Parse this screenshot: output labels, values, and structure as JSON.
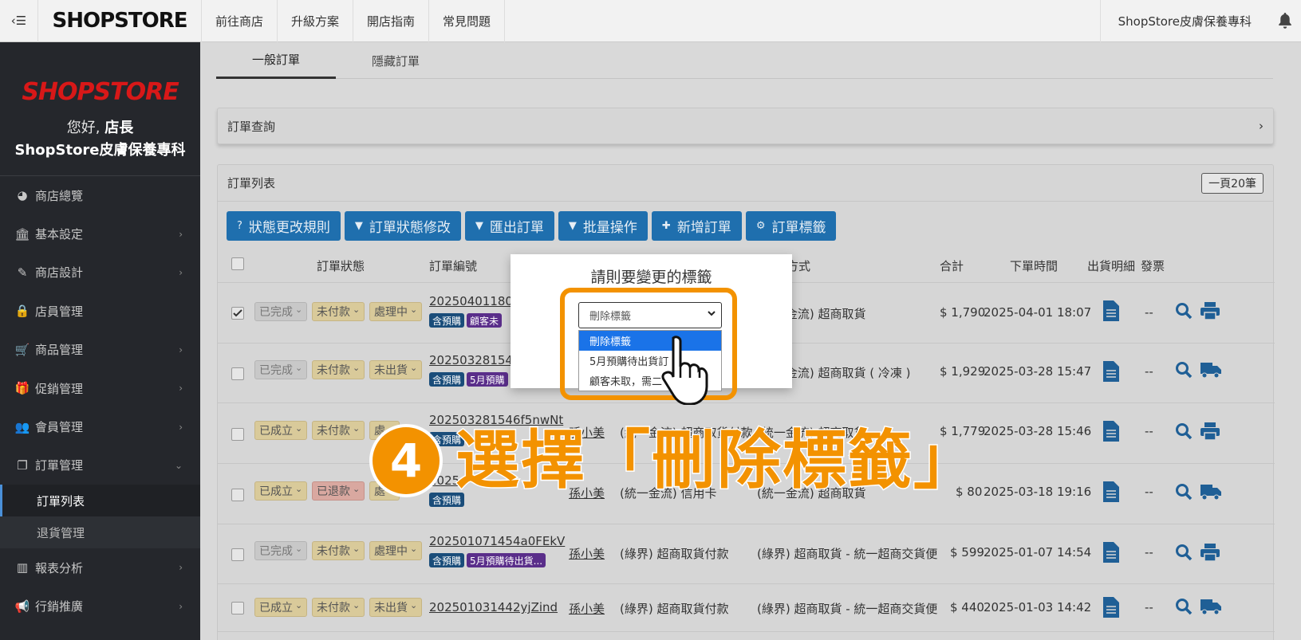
{
  "topbar": {
    "toggle": "‹☰",
    "logo": "SHOPSTORE",
    "nav": [
      "前往商店",
      "升級方案",
      "開店指南",
      "常見問題"
    ],
    "store_name": "ShopStore皮膚保養專科"
  },
  "sidebar": {
    "logo": "SHOPSTORE",
    "greeting": "您好,",
    "role": "店長",
    "store": "ShopStore皮膚保養專科",
    "items": [
      {
        "label": "商店總覽",
        "icon": "dashboard-icon",
        "glyph": "◕",
        "chev": ""
      },
      {
        "label": "基本設定",
        "icon": "bank-icon",
        "glyph": "🏛",
        "chev": "›"
      },
      {
        "label": "商店設計",
        "icon": "magic-wand-icon",
        "glyph": "✎",
        "chev": "›"
      },
      {
        "label": "店員管理",
        "icon": "user-lock-icon",
        "glyph": "🔒",
        "chev": ""
      },
      {
        "label": "商品管理",
        "icon": "cart-icon",
        "glyph": "🛒",
        "chev": "›"
      },
      {
        "label": "促銷管理",
        "icon": "gift-icon",
        "glyph": "🎁",
        "chev": "›"
      },
      {
        "label": "會員管理",
        "icon": "users-icon",
        "glyph": "👥",
        "chev": "›"
      },
      {
        "label": "訂單管理",
        "icon": "copy-icon",
        "glyph": "❐",
        "chev": "⌄"
      }
    ],
    "sub_items": [
      "訂單列表",
      "退貨管理"
    ],
    "items_after": [
      {
        "label": "報表分析",
        "icon": "bar-chart-icon",
        "glyph": "▥",
        "chev": "›"
      },
      {
        "label": "行銷推廣",
        "icon": "bullhorn-icon",
        "glyph": "📢",
        "chev": "›"
      }
    ]
  },
  "tabs": [
    "一般訂單",
    "隱藏訂單"
  ],
  "query": {
    "label": "訂單查詢",
    "chev": "›"
  },
  "list": {
    "title": "訂單列表",
    "per_page": "一頁20筆",
    "toolbar": [
      {
        "label": "狀態更改規則",
        "glyph": "?"
      },
      {
        "label": "訂單狀態修改",
        "glyph": "▼"
      },
      {
        "label": "匯出訂單",
        "glyph": "▼"
      },
      {
        "label": "批量操作",
        "glyph": "▼"
      },
      {
        "label": "新增訂單",
        "glyph": "✚"
      },
      {
        "label": "訂單標籤",
        "glyph": "⚙"
      }
    ],
    "headers": {
      "status": "訂單狀態",
      "id": "訂單編號",
      "ship": "貨方式",
      "total": "合計",
      "time": "下單時間",
      "detail": "出貨明細",
      "invoice": "發票"
    },
    "rows": [
      {
        "checked": true,
        "s1": "已完成",
        "s2": "未付款",
        "s3": "處理中",
        "id": "20250401180",
        "tags": [
          "含預購",
          "顧客未"
        ],
        "member": "",
        "pay": "",
        "ship": "(統一金流) 超商取貨",
        "total": "$ 1,790",
        "time": "2025-04-01 18:07",
        "invoice": "--"
      },
      {
        "checked": false,
        "s1": "已完成",
        "s2": "未付款",
        "s3": "未出貨",
        "id": "20250328154",
        "tags": [
          "含預購",
          "5月預購"
        ],
        "member": "",
        "pay": "",
        "ship": "(統一金流) 超商取貨 ( 冷凍 )",
        "total": "$ 1,929",
        "time": "2025-03-28 15:47",
        "invoice": "--"
      },
      {
        "checked": false,
        "s1": "已成立",
        "s2": "未付款",
        "s3": "處",
        "id": "202503281546f5nwNt",
        "tags": [
          "含預購"
        ],
        "member": "孫小美",
        "pay": "(統一金流) 超商取貨付款",
        "ship": "(統一金流) 超商取貨",
        "total": "$ 1,779",
        "time": "2025-03-28 15:46",
        "invoice": "--"
      },
      {
        "checked": false,
        "s1": "已成立",
        "s2": "已退款",
        "s3": "處",
        "id": "2025",
        "tags": [
          "含預購"
        ],
        "member": "孫小美",
        "pay": "(統一金流) 信用卡",
        "ship": "(統一金流) 超商取貨",
        "total": "$ 80",
        "time": "2025-03-18 19:16",
        "invoice": "--"
      },
      {
        "checked": false,
        "s1": "已完成",
        "s2": "未付款",
        "s3": "處理中",
        "id": "202501071454a0FEkV",
        "tags": [
          "含預購",
          "5月預購待出貨..."
        ],
        "member": "孫小美",
        "pay": "(綠界) 超商取貨付款",
        "ship": "(綠界) 超商取貨 - 統一超商交貨便",
        "total": "$ 599",
        "time": "2025-01-07 14:54",
        "invoice": "--"
      },
      {
        "checked": false,
        "s1": "已成立",
        "s2": "未付款",
        "s3": "未出貨",
        "id": "202501031442yjZind",
        "tags": [],
        "member": "孫小美",
        "pay": "(綠界) 超商取貨付款",
        "ship": "(綠界) 超商取貨 - 統一超商交貨便",
        "total": "$ 440",
        "time": "2025-01-03 14:42",
        "invoice": "--"
      }
    ]
  },
  "modal": {
    "title": "請則要變更的標籤",
    "select_value": "刪除標籤",
    "options": [
      "刪除標籤",
      "5月預購待出貨訂",
      "顧客未取，需二"
    ]
  },
  "callout": {
    "number": "4",
    "text": "選擇「刪除標籤」"
  },
  "colors": {
    "accent": "#f39200",
    "button": "#1f6fae",
    "sidebar": "#25272c"
  }
}
